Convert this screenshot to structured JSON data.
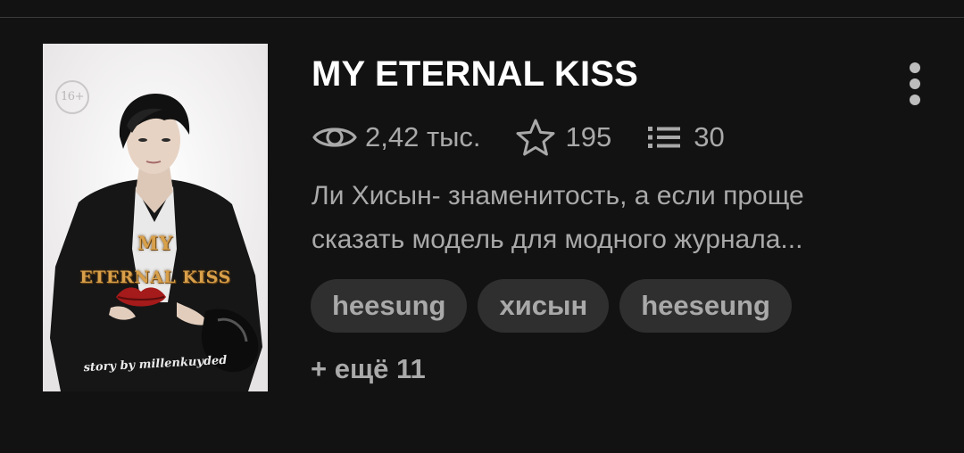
{
  "story": {
    "title": "MY ETERNAL KISS",
    "stats": {
      "views": "2,42 тыс.",
      "votes": "195",
      "parts": "30"
    },
    "description_lines": [
      "Ли Хисын- знаменитость, а если проще",
      "сказать модель для модного журнала..."
    ],
    "tags": [
      "heesung",
      "хисын",
      "heeseung"
    ],
    "more_tags": "+ ещё 11",
    "cover": {
      "age_badge": "16+",
      "title_line_1": "MY",
      "title_line_2": "ETERNAL KISS",
      "credit": "story by millenkuyded"
    }
  },
  "icons": {
    "views": "eye-icon",
    "votes": "star-icon",
    "parts": "list-icon",
    "menu": "more-vertical-icon"
  },
  "colors": {
    "background": "#121212",
    "title": "#ffffff",
    "secondary_text": "#a9a9a9",
    "tag_background": "#2f2f2f",
    "cover_accent": "#d9a04a"
  }
}
